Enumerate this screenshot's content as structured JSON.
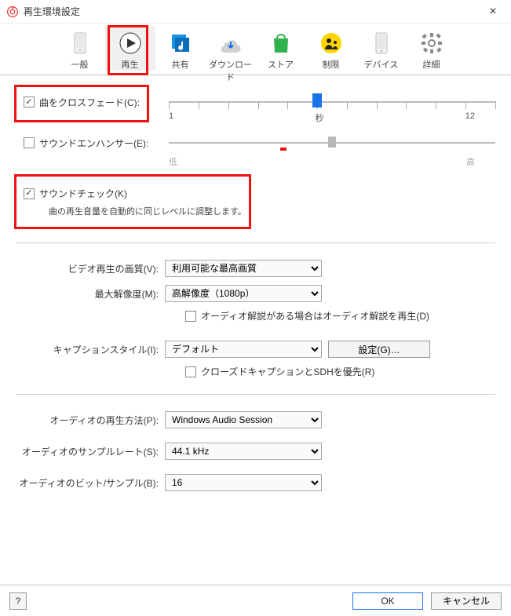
{
  "window": {
    "title": "再生環境設定"
  },
  "tabs": {
    "items": [
      {
        "label": "一般"
      },
      {
        "label": "再生"
      },
      {
        "label": "共有"
      },
      {
        "label": "ダウンロード"
      },
      {
        "label": "ストア"
      },
      {
        "label": "制限"
      },
      {
        "label": "デバイス"
      },
      {
        "label": "詳細"
      }
    ]
  },
  "crossfade": {
    "checked": true,
    "label": "曲をクロスフェード(C):",
    "min_label": "1",
    "unit_label": "秒",
    "max_label": "12"
  },
  "enhancer": {
    "checked": false,
    "label": "サウンドエンハンサー(E):",
    "low_label": "低",
    "high_label": "高"
  },
  "soundcheck": {
    "checked": true,
    "label": "サウンドチェック(K)",
    "desc": "曲の再生音量を自動的に同じレベルに調整します。"
  },
  "video_quality": {
    "label": "ビデオ再生の画質(V):",
    "value": "利用可能な最高画質"
  },
  "max_res": {
    "label": "最大解像度(M):",
    "value": "高解像度（1080p）"
  },
  "audio_desc_check": {
    "checked": false,
    "label": "オーディオ解説がある場合はオーディオ解説を再生(D)"
  },
  "caption_style": {
    "label": "キャプションスタイル(I):",
    "value": "デフォルト",
    "button": "設定(G)…"
  },
  "cc_priority": {
    "checked": false,
    "label": "クローズドキャプションとSDHを優先(R)"
  },
  "audio_method": {
    "label": "オーディオの再生方法(P):",
    "value": "Windows Audio Session"
  },
  "sample_rate": {
    "label": "オーディオのサンプルレート(S):",
    "value": "44.1 kHz"
  },
  "bits_per_sample": {
    "label": "オーディオのビット/サンプル(B):",
    "value": "16"
  },
  "footer": {
    "help": "?",
    "ok": "OK",
    "cancel": "キャンセル"
  }
}
